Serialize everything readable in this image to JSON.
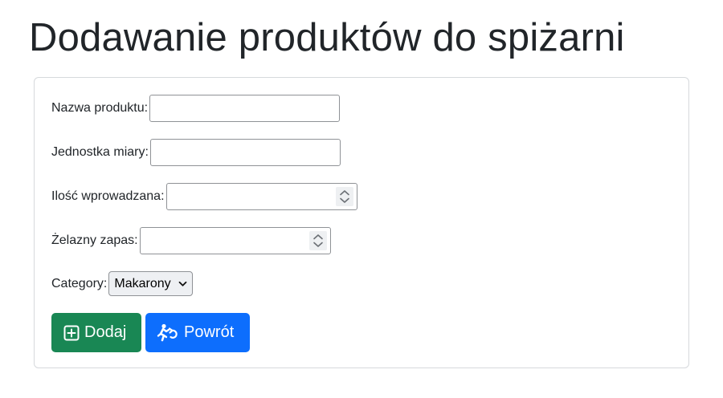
{
  "page": {
    "title": "Dodawanie produktów do spiżarni"
  },
  "form": {
    "product_name": {
      "label": "Nazwa produktu:",
      "value": "",
      "placeholder": ""
    },
    "unit": {
      "label": "Jednostka miary:",
      "value": "",
      "placeholder": ""
    },
    "quantity": {
      "label": "Ilość wprowadzana:",
      "value": "",
      "icon": "spinner-icon"
    },
    "reserve": {
      "label": "Żelazny zapas:",
      "value": "",
      "icon": "spinner-icon"
    },
    "category": {
      "label": "Category:",
      "selected": "Makarony",
      "icon": "chevron-down-icon"
    }
  },
  "buttons": {
    "add": {
      "label": "Dodaj",
      "icon": "plus-square-icon",
      "color": "#198754"
    },
    "back": {
      "label": "Powrót",
      "icon": "running-person-return-icon",
      "color": "#0d6efd"
    }
  }
}
